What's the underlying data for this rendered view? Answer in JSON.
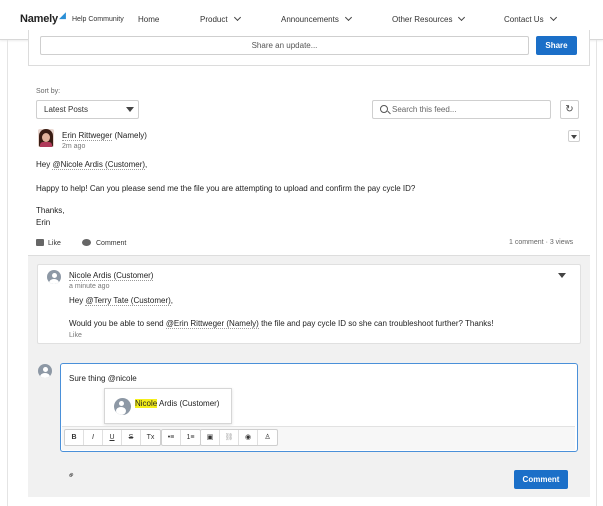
{
  "nav": {
    "logo": "Namely",
    "logo_sub": "Help Community",
    "items": [
      "Home",
      "Product",
      "Announcements",
      "Other Resources",
      "Contact Us"
    ]
  },
  "share": {
    "placeholder": "Share an update...",
    "button": "Share"
  },
  "sort": {
    "label": "Sort by:",
    "value": "Latest Posts"
  },
  "search": {
    "placeholder": "Search this feed..."
  },
  "post": {
    "author": "Erin Rittweger",
    "author_suffix": "(Namely)",
    "time": "2m ago",
    "greeting_prefix": "Hey ",
    "greeting_mention": "@Nicole Ardis (Customer)",
    "greeting_suffix": ",",
    "body": "Happy to help! Can you please send me the file you are attempting to upload and confirm the pay cycle ID?",
    "signoff": "Thanks,",
    "signature": "Erin",
    "like": "Like",
    "comment": "Comment",
    "stats": "1 comment · 3 views"
  },
  "comment": {
    "author": "Nicole Ardis (Customer)",
    "time": "a minute ago",
    "line1_prefix": "Hey ",
    "line1_mention": "@Terry Tate (Customer)",
    "line1_suffix": ",",
    "line2_prefix": "Would you be able to send ",
    "line2_mention": "@Erin Rittweger (Namely)",
    "line2_suffix": " the file and pay cycle ID so she can troubleshoot further? Thanks!",
    "like": "Like"
  },
  "reply": {
    "text": "Sure thing @nicole",
    "suggestion_match": "Nicole",
    "suggestion_rest": " Ardis (Customer)",
    "toolbar": [
      "B",
      "I",
      "U",
      "S",
      "Tx",
      "•≡",
      "1≡",
      "▣",
      "⛓",
      "◉",
      "♙"
    ],
    "submit": "Comment"
  },
  "colors": {
    "accent": "#1b6fc8",
    "highlight": "#f5ef1c",
    "focus": "#4a90d9"
  }
}
